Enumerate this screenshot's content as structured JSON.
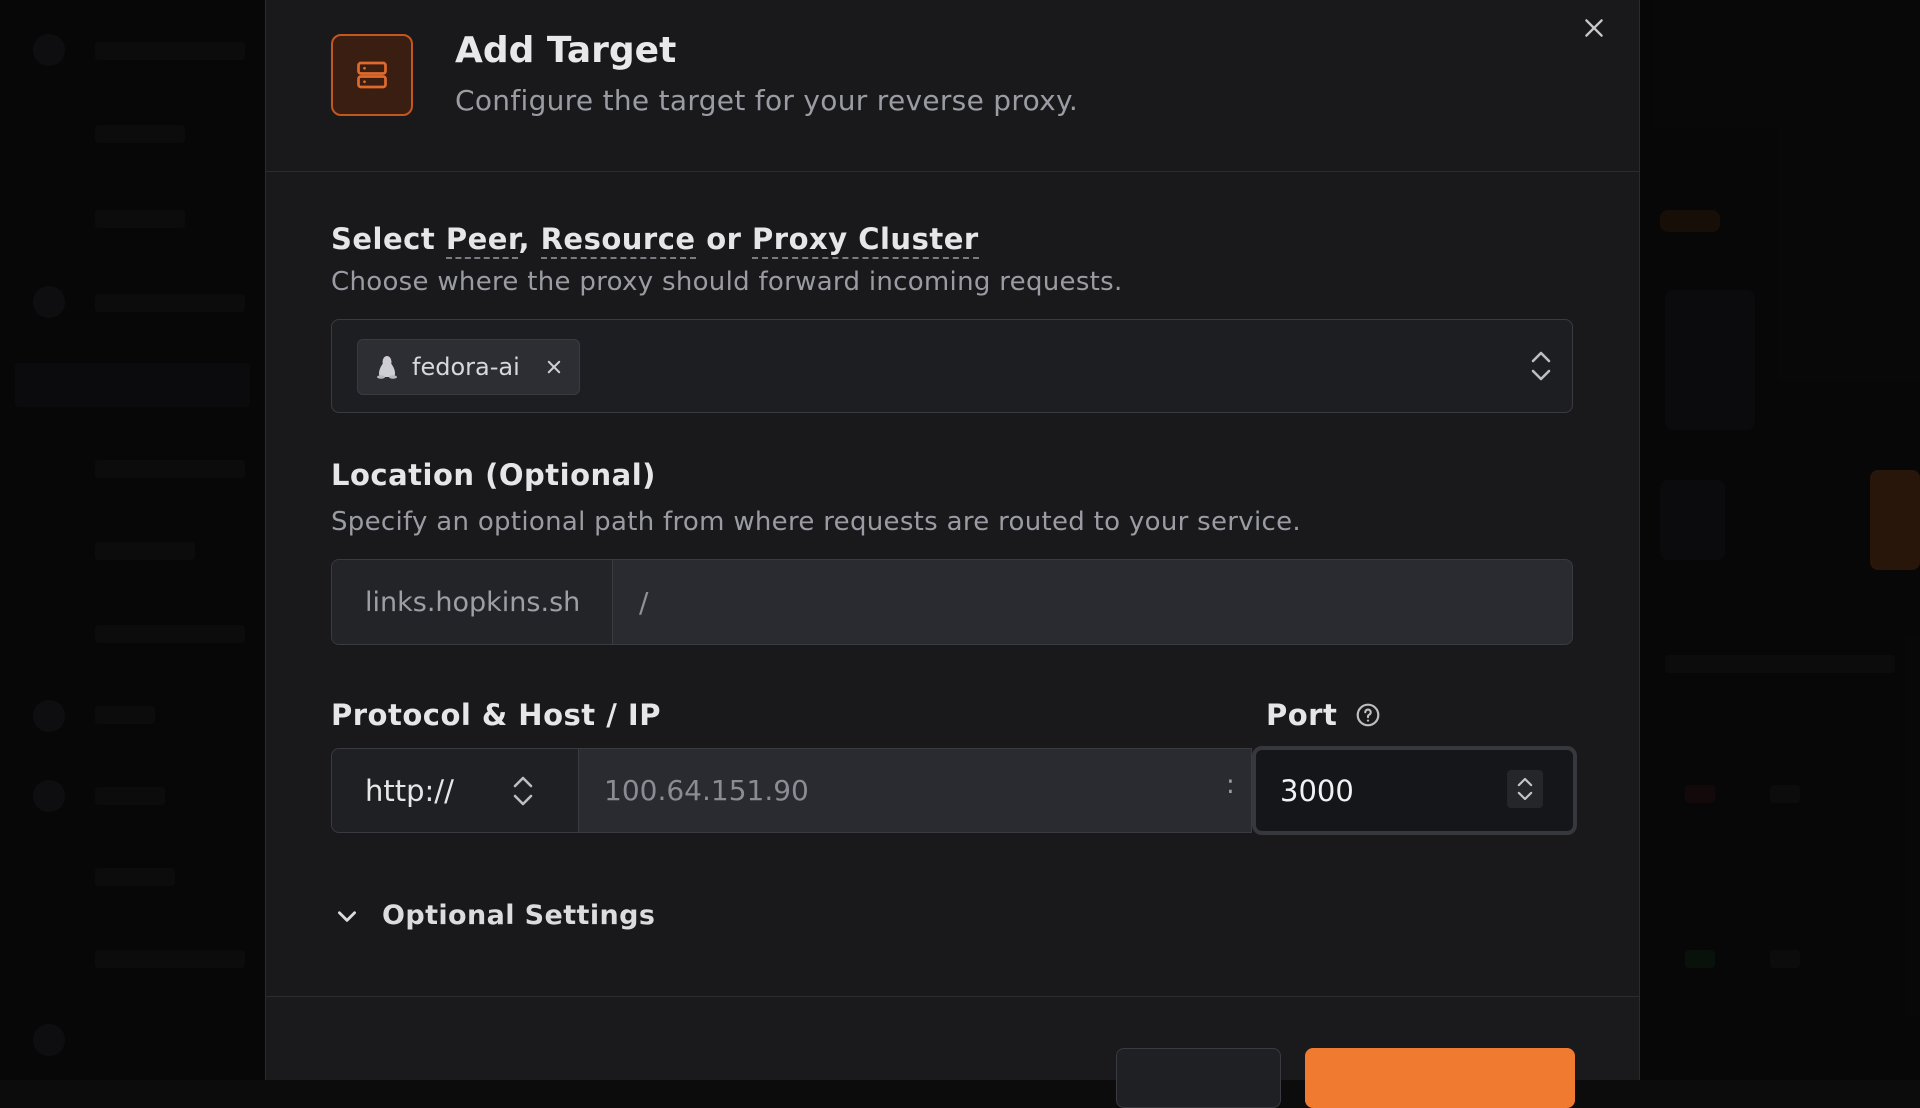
{
  "dialog": {
    "title": "Add Target",
    "subtitle": "Configure the target for your reverse proxy."
  },
  "target_select": {
    "label_prefix": "Select ",
    "label_peer": "Peer",
    "label_sep1": ", ",
    "label_resource": "Resource",
    "label_sep2": " or ",
    "label_cluster": "Proxy Cluster",
    "help": "Choose where the proxy should forward incoming requests.",
    "selected_chip": "fedora-ai"
  },
  "location": {
    "label": "Location (Optional)",
    "help": "Specify an optional path from where requests are routed to your service.",
    "domain_prefix": "links.hopkins.sh",
    "path_placeholder": "/"
  },
  "protocol_host": {
    "label": "Protocol & Host / IP",
    "protocol_value": "http://",
    "host_placeholder": "100.64.151.90",
    "separator": ":"
  },
  "port": {
    "label": "Port",
    "value": "3000"
  },
  "optional_settings": {
    "label": "Optional Settings"
  },
  "colors": {
    "accent": "#f07a2f",
    "accent_dark": "#3a1e12",
    "modal_bg": "#19191b"
  }
}
